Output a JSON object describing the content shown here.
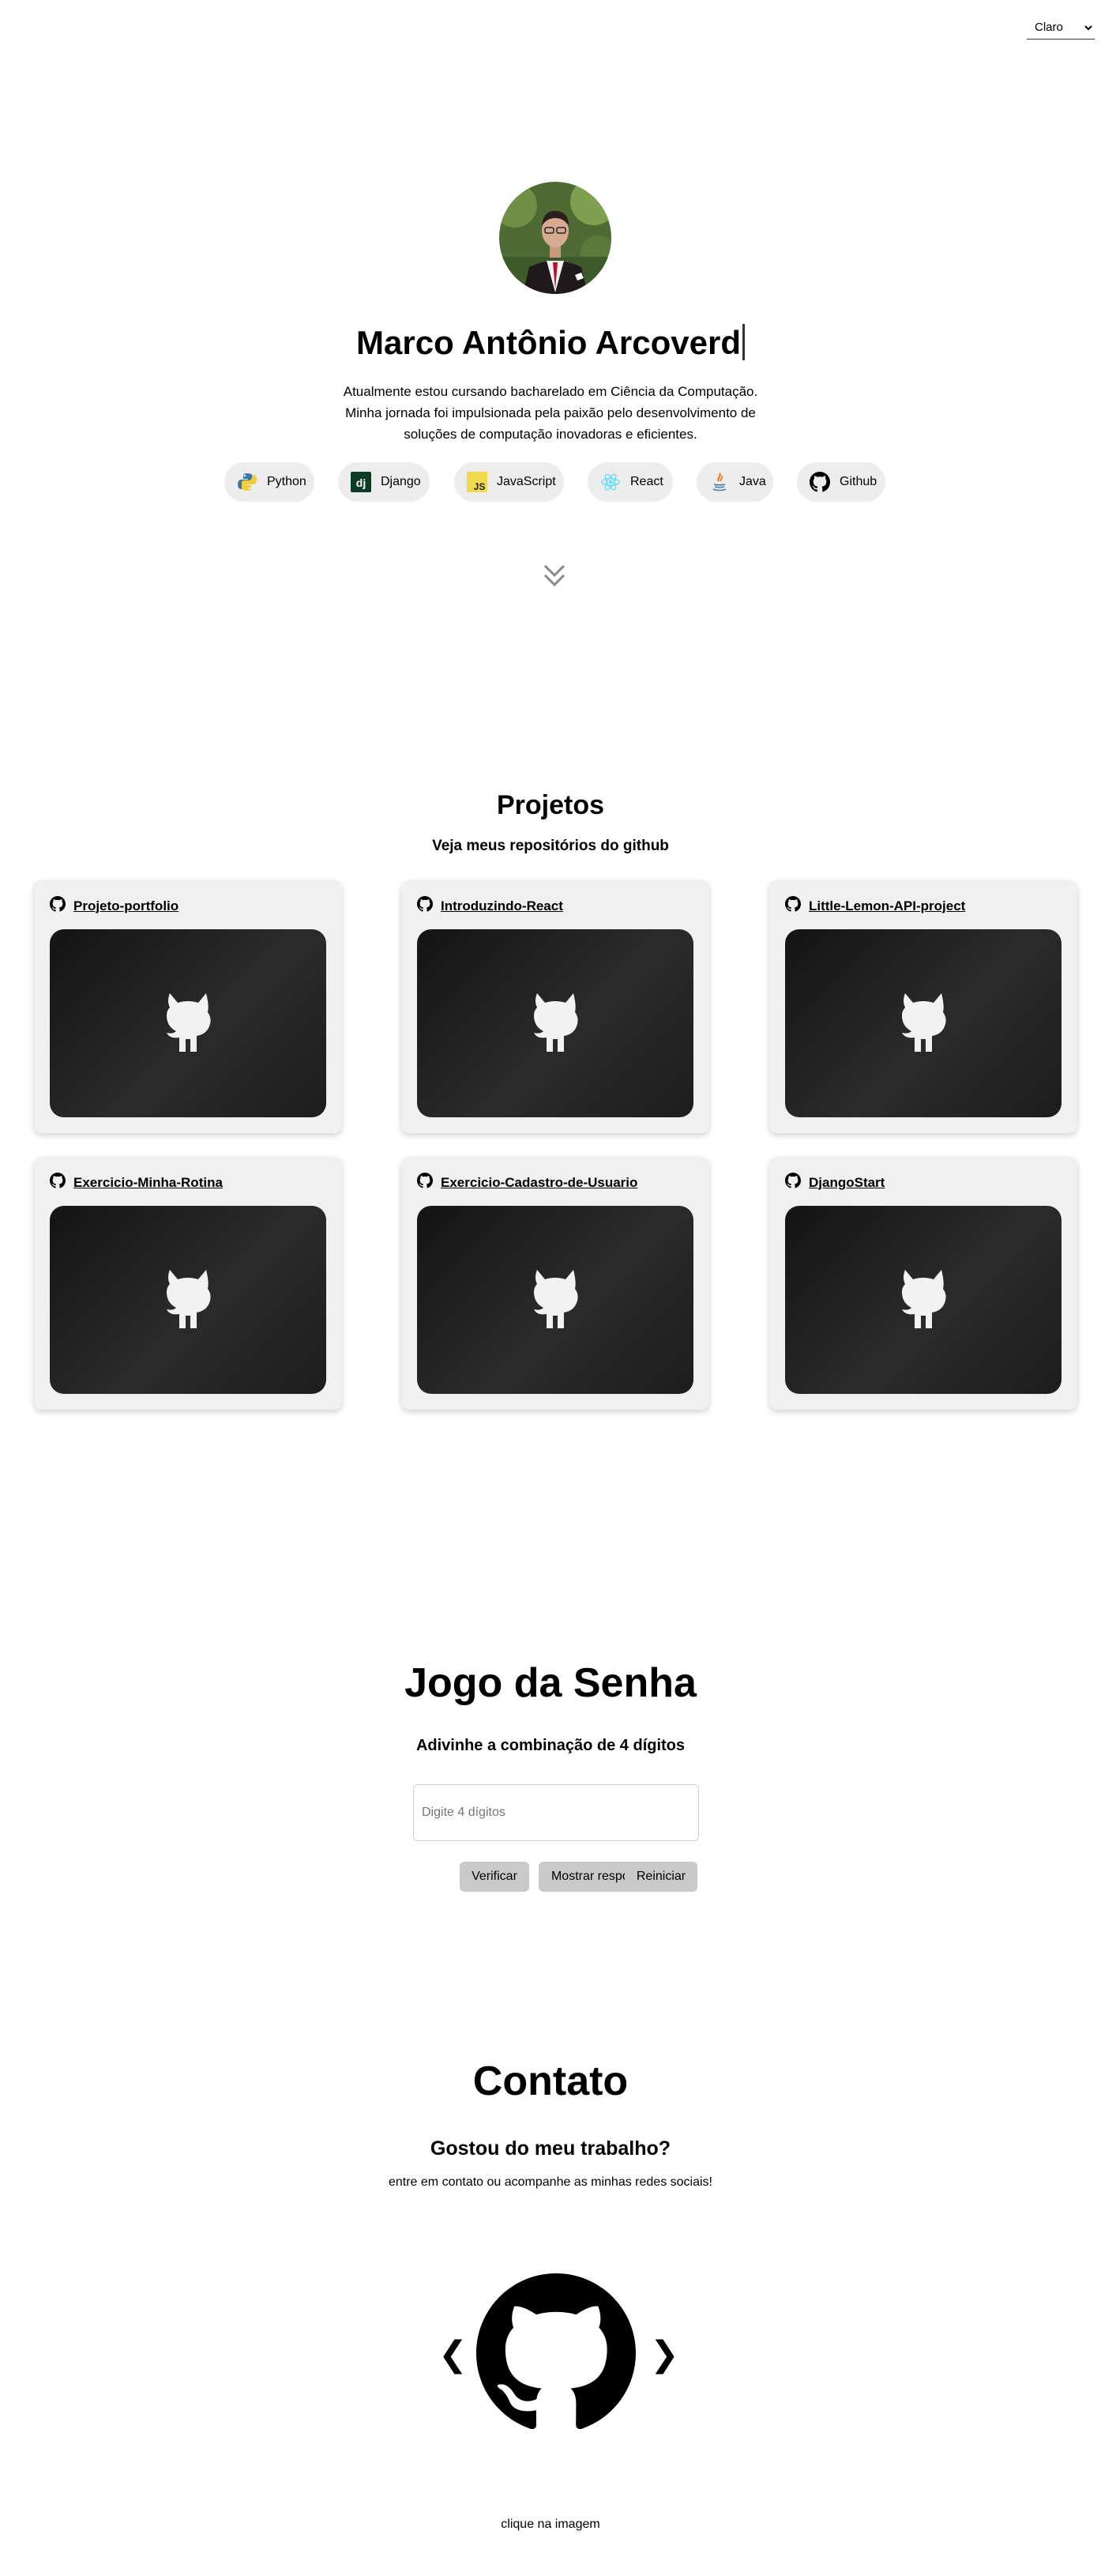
{
  "theme": {
    "selected": "Claro"
  },
  "hero": {
    "name": "Marco Antônio Arcoverd",
    "bio": "Atualmente estou cursando bacharelado em Ciência da Computação. Minha jornada foi impulsionada pela paixão pelo desenvolvimento de soluções de computação inovadoras e eficientes.",
    "skills": [
      {
        "label": "Python",
        "icon": "python-icon"
      },
      {
        "label": "Django",
        "icon": "django-icon"
      },
      {
        "label": "JavaScript",
        "icon": "javascript-icon"
      },
      {
        "label": "React",
        "icon": "react-icon"
      },
      {
        "label": "Java",
        "icon": "java-icon"
      },
      {
        "label": "Github",
        "icon": "github-icon"
      }
    ]
  },
  "projects": {
    "title": "Projetos",
    "subtitle": "Veja meus repositórios do github",
    "items": [
      {
        "name": "Projeto-portfolio"
      },
      {
        "name": "Introduzindo-React"
      },
      {
        "name": "Little-Lemon-API-project"
      },
      {
        "name": "Exercicio-Minha-Rotina"
      },
      {
        "name": "Exercicio-Cadastro-de-Usuario"
      },
      {
        "name": "DjangoStart"
      }
    ]
  },
  "game": {
    "title": "Jogo da Senha",
    "subtitle": "Adivinhe a combinação de 4 dígitos",
    "placeholder": "Digite 4 dígitos",
    "verify_label": "Verificar",
    "show_label": "Mostrar resposta",
    "reset_label": "Reiniciar"
  },
  "contact": {
    "title": "Contato",
    "subtitle": "Gostou do meu trabalho?",
    "text": "entre em contato ou acompanhe as minhas redes sociais!",
    "prev": "❮",
    "next": "❯",
    "hint": "clique na imagem",
    "current_icon": "github-icon"
  },
  "colors": {
    "card_bg": "#f0f0f0",
    "button_bg": "#c9c9c9",
    "text": "#000000"
  }
}
